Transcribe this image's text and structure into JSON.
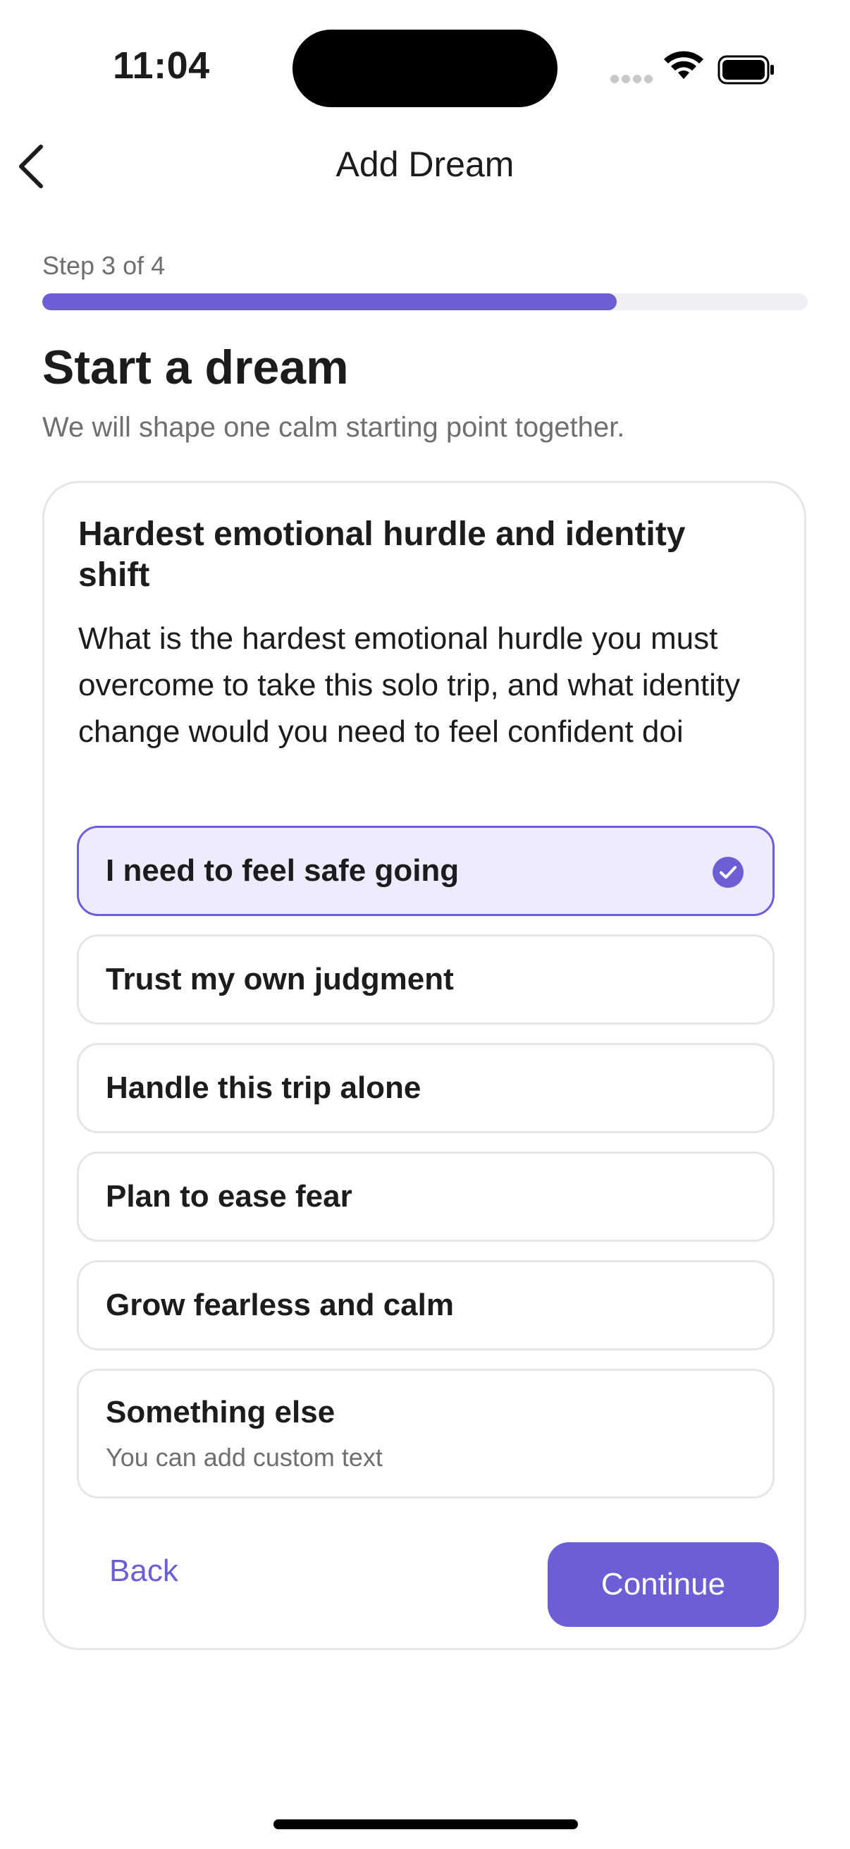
{
  "status_bar": {
    "time": "11:04"
  },
  "header": {
    "title": "Add Dream",
    "back_icon": "chevron-left-icon"
  },
  "progress": {
    "step_label": "Step 3 of 4",
    "fraction": 0.75
  },
  "page": {
    "title": "Start a dream",
    "subtitle": "We will shape one calm starting point together."
  },
  "question": {
    "title": "Hardest emotional hurdle and identity shift",
    "body": "What is the hardest emotional hurdle you must overcome to take this solo trip, and what identity change would you need to feel confident doi"
  },
  "options": [
    {
      "label": "I need to feel safe going",
      "selected": true
    },
    {
      "label": "Trust my own judgment",
      "selected": false
    },
    {
      "label": "Handle this trip alone",
      "selected": false
    },
    {
      "label": "Plan to ease fear",
      "selected": false
    },
    {
      "label": "Grow fearless and calm",
      "selected": false
    },
    {
      "label": "Something else",
      "sublabel": "You can add custom text",
      "selected": false
    }
  ],
  "actions": {
    "back_label": "Back",
    "continue_label": "Continue"
  },
  "colors": {
    "accent": "#6c5fd6",
    "selected_bg": "#efebfd",
    "text": "#1c1c1e",
    "muted": "#6e6e73"
  }
}
